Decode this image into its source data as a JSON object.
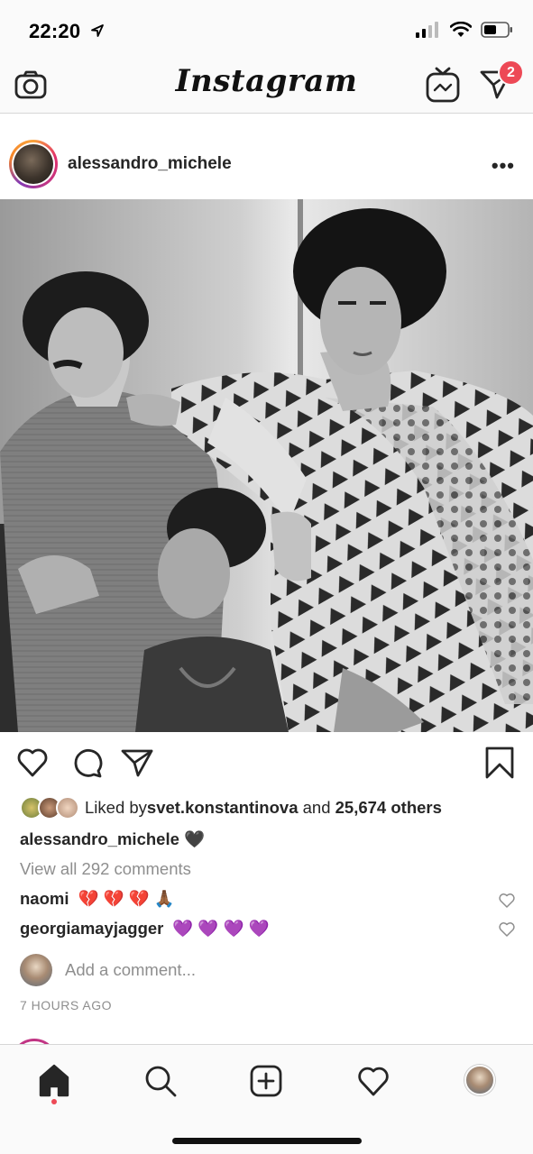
{
  "status_bar": {
    "time": "22:20"
  },
  "nav": {
    "logo": "Instagram",
    "direct_badge": "2"
  },
  "post": {
    "username": "alessandro_michele",
    "more": "•••",
    "likes": {
      "prefix": "Liked by ",
      "user": "svet.konstantinova",
      "middle": " and ",
      "count": "25,674 others"
    },
    "caption": {
      "username": "alessandro_michele",
      "emoji": "🖤"
    },
    "view_all": "View all 292 comments",
    "comments": [
      {
        "username": "naomi",
        "emoji": [
          "💔",
          "💔",
          "💔",
          "🙏🏾"
        ]
      },
      {
        "username": "georgiamayjagger",
        "emoji": [
          "💜",
          "💜",
          "💜",
          "💜"
        ]
      }
    ],
    "add_comment_placeholder": "Add a comment...",
    "time_ago": "7 HOURS AGO"
  },
  "colors": {
    "badge": "#ed4956",
    "muted": "#8e8e8e",
    "text": "#262626"
  },
  "icons": [
    "camera-icon",
    "igtv-icon",
    "direct-icon",
    "heart-icon",
    "comment-icon",
    "share-icon",
    "bookmark-icon",
    "home-icon",
    "search-icon",
    "new-post-icon",
    "activity-icon",
    "profile-avatar"
  ]
}
